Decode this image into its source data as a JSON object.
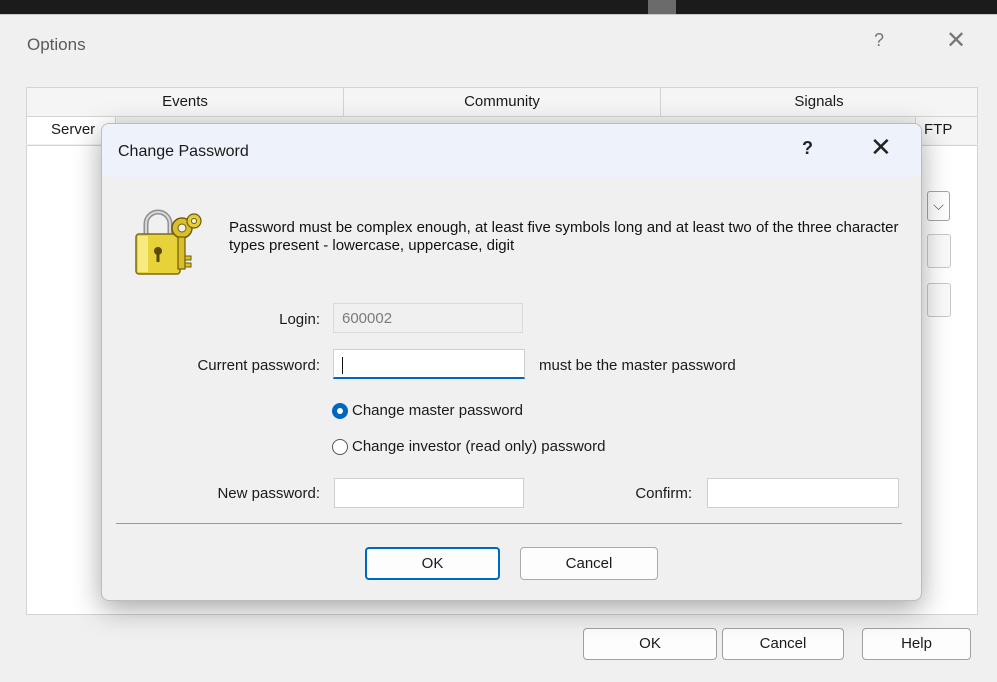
{
  "options_window": {
    "title": "Options",
    "help_glyph": "?",
    "close_glyph": "✕",
    "tabs_row1": [
      "Events",
      "Community",
      "Signals"
    ],
    "tab_server": "Server",
    "tab_ftp": "FTP",
    "dropdown_glyph": "⌵",
    "buttons": {
      "ok": "OK",
      "cancel": "Cancel",
      "help": "Help"
    }
  },
  "dialog": {
    "title": "Change Password",
    "help_glyph": "?",
    "close_glyph": "✕",
    "icon": "lock-with-keys-icon",
    "message": "Password must be complex enough, at least five symbols long and at least two of the three character types present - lowercase, uppercase, digit",
    "login": {
      "label": "Login:",
      "value": "600002"
    },
    "current_password": {
      "label": "Current password:",
      "value": "",
      "hint": "must be the master password"
    },
    "radios": [
      {
        "label": "Change master password",
        "selected": true
      },
      {
        "label": "Change investor (read only) password",
        "selected": false
      }
    ],
    "new_password": {
      "label": "New password:",
      "value": ""
    },
    "confirm": {
      "label": "Confirm:",
      "value": ""
    },
    "buttons": {
      "ok": "OK",
      "cancel": "Cancel"
    },
    "accent_color": "#0067c0"
  }
}
